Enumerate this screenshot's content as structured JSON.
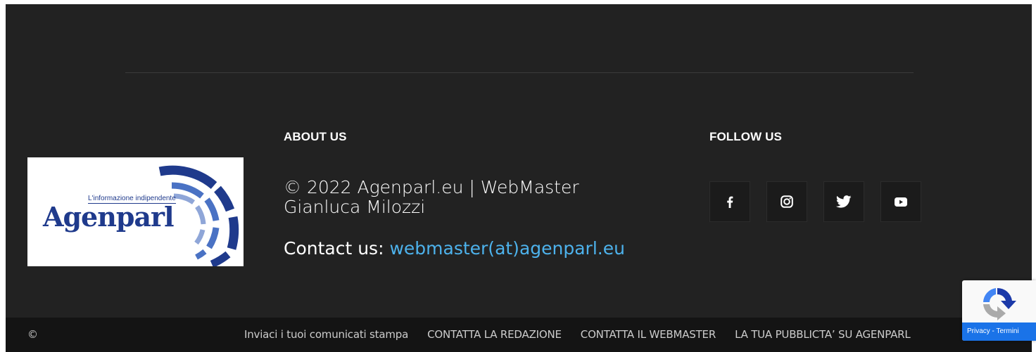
{
  "about": {
    "title": "ABOUT US",
    "copyright_text": "© 2022 Agenparl.eu | WebMaster Gianluca Milozzi",
    "contact_label": "Contact us: ",
    "contact_email": "webmaster(at)agenparl.eu"
  },
  "follow": {
    "title": "FOLLOW US",
    "icons": [
      "facebook-icon",
      "instagram-icon",
      "twitter-icon",
      "youtube-icon"
    ]
  },
  "logo": {
    "brand": "Agenparl",
    "tagline": "L'informazione indipendente"
  },
  "footer": {
    "copyright_symbol": "©",
    "menu": [
      "Inviaci i tuoi comunicati stampa",
      "CONTATTA LA REDAZIONE",
      "CONTATTA IL WEBMASTER",
      "LA TUA PUBBLICTA’ SU AGENPARL"
    ]
  },
  "recaptcha": {
    "links": "Privacy - Termini"
  },
  "colors": {
    "background": "#222222",
    "bottom_bar": "#141414",
    "link": "#4db2ec",
    "logo_blue": "#1f3a8c"
  }
}
